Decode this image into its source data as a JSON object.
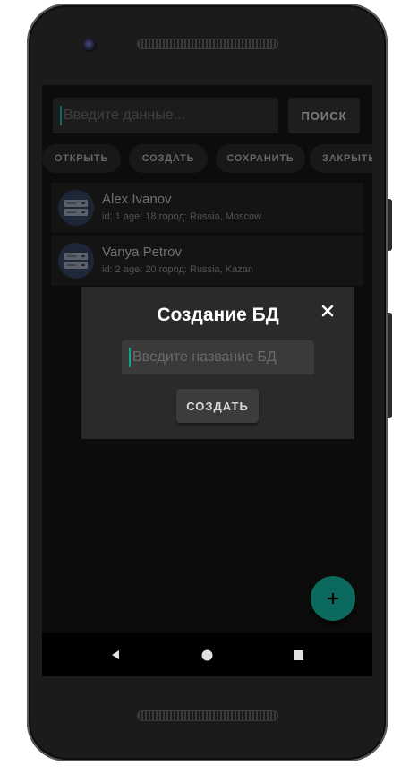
{
  "search": {
    "placeholder": "Введите данные...",
    "button_label": "ПОИСК"
  },
  "actions": [
    {
      "label": "ОТКРЫТЬ"
    },
    {
      "label": "СОЗДАТЬ"
    },
    {
      "label": "СОХРАНИТЬ"
    },
    {
      "label": "ЗАКРЫТЬ"
    }
  ],
  "records": [
    {
      "name": "Alex Ivanov",
      "info": "id: 1 age: 18 город: Russia, Moscow",
      "icon": "database-icon"
    },
    {
      "name": "Vanya Petrov",
      "info": "id: 2 age: 20 город: Russia, Kazan",
      "icon": "database-icon"
    }
  ],
  "dialog": {
    "title": "Создание БД",
    "input_placeholder": "Введите название БД",
    "create_label": "СОЗДАТЬ",
    "close_icon": "close-icon"
  },
  "fab": {
    "icon": "plus-icon",
    "color": "#0b6a5d"
  },
  "colors": {
    "accent": "#13a28f",
    "background": "#121212",
    "card": "#1f1f1f",
    "dialog": "#2a2a2a"
  }
}
